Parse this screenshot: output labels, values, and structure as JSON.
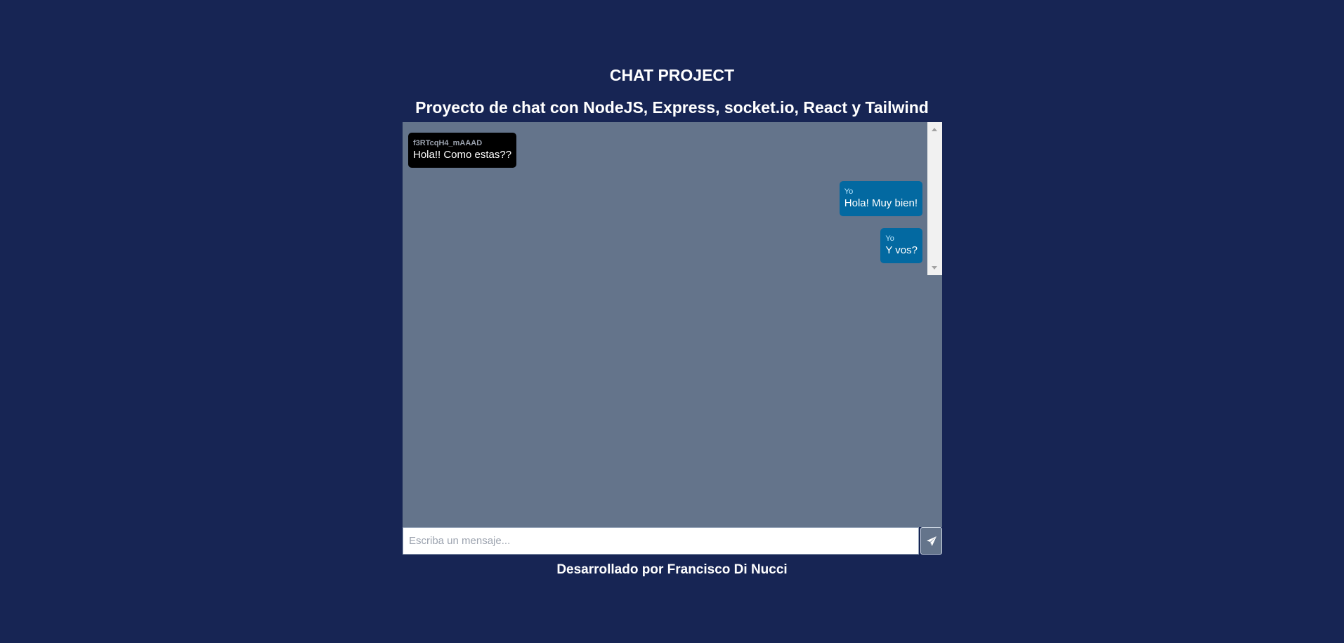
{
  "header": {
    "title": "CHAT PROJECT",
    "subtitle": "Proyecto de chat con NodeJS, Express, socket.io, React y Tailwind"
  },
  "messages": [
    {
      "sender": "f3RTcqH4_mAAAD",
      "text": "Hola!! Como estas??",
      "own": false
    },
    {
      "sender": "Yo",
      "text": "Hola! Muy bien!",
      "own": true
    },
    {
      "sender": "Yo",
      "text": "Y vos?",
      "own": true
    }
  ],
  "composer": {
    "placeholder": "Escriba un mensaje...",
    "value": "",
    "send_icon": "paper-plane-icon"
  },
  "footer": {
    "text": "Desarrollado por Francisco Di Nucci"
  },
  "colors": {
    "background": "#172554",
    "chat_area": "#64748b",
    "own_bubble": "#0369a1",
    "other_bubble": "#000000"
  }
}
